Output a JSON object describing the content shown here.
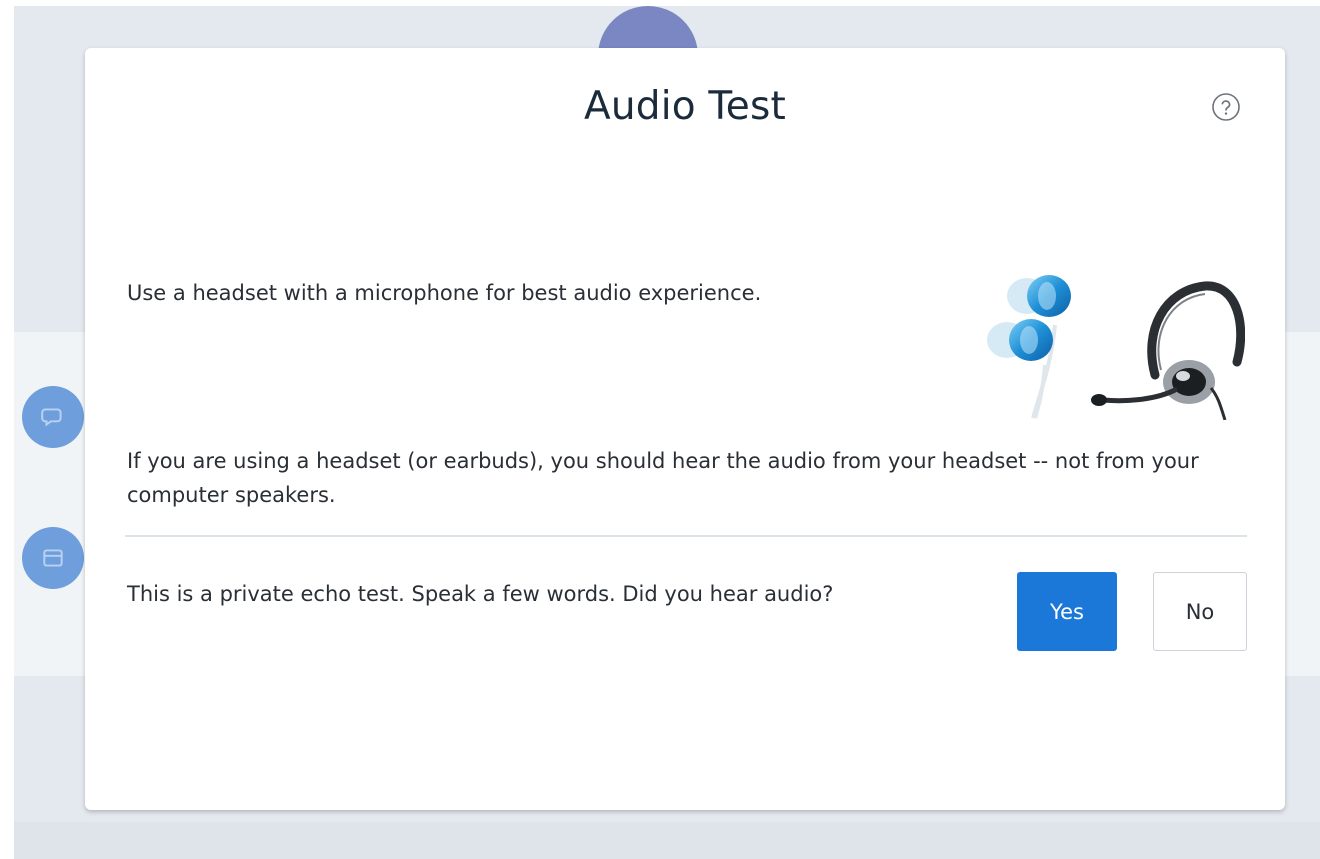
{
  "modal": {
    "title": "Audio Test",
    "help_icon": "help-circle-icon",
    "headset_tip": "Use a headset with a microphone for best audio experience.",
    "headset_note": "If you are using a headset (or earbuds), you should hear the audio from your headset -- not from your computer speakers.",
    "echo_question": "This is a private echo test.  Speak a few words.  Did you hear audio?",
    "yes_label": "Yes",
    "no_label": "No"
  },
  "background": {
    "side_buttons": [
      "chat-icon",
      "notes-icon"
    ]
  },
  "colors": {
    "primary": "#1b78d8",
    "title_text": "#1b2b3c",
    "body_text": "#2a2f36",
    "backdrop": "#e4e9ef",
    "side_button": "#6e9fdc"
  }
}
